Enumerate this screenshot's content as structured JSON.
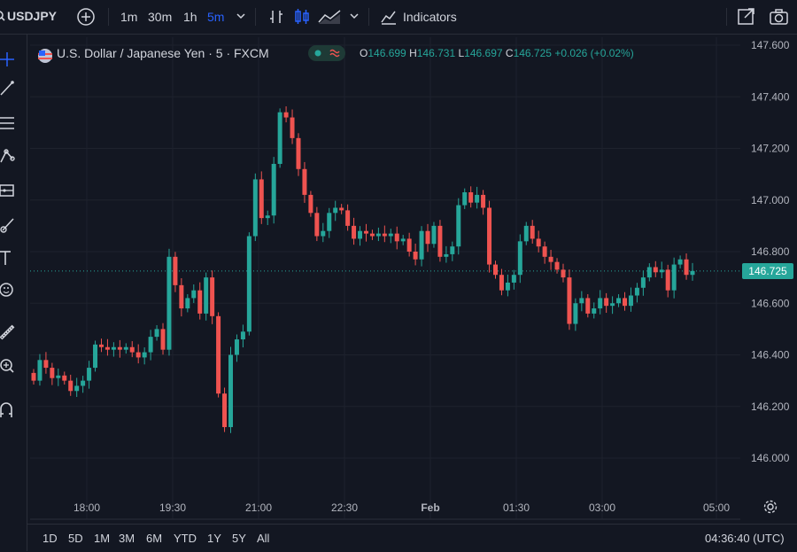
{
  "topbar": {
    "symbol": "USDJPY",
    "timeframes": [
      "1m",
      "30m",
      "1h",
      "5m"
    ],
    "active_timeframe": "5m",
    "indicators_label": "Indicators"
  },
  "legend": {
    "title": "U.S. Dollar / Japanese Yen · 5 · FXCM",
    "o_label": "O",
    "o_value": "146.699",
    "h_label": "H",
    "h_value": "146.731",
    "l_label": "L",
    "l_value": "146.697",
    "c_label": "C",
    "c_value": "146.725",
    "change": "+0.026 (+0.02%)"
  },
  "price_axis": {
    "ticks": [
      "147.600",
      "147.400",
      "147.200",
      "147.000",
      "146.800",
      "146.600",
      "146.400",
      "146.200",
      "146.000"
    ],
    "current_price": "146.725"
  },
  "time_axis": {
    "ticks": [
      "18:00",
      "19:30",
      "21:00",
      "22:30",
      "Feb",
      "01:30",
      "03:00",
      "05:00"
    ]
  },
  "bottombar": {
    "ranges": [
      "1D",
      "5D",
      "1M",
      "3M",
      "6M",
      "YTD",
      "1Y",
      "5Y",
      "All"
    ],
    "clock": "04:36:40 (UTC)"
  },
  "colors": {
    "up": "#26a69a",
    "down": "#ef5350",
    "background": "#131722",
    "accent": "#2962ff"
  },
  "chart_data": {
    "type": "candlestick",
    "xlabel": "",
    "ylabel": "",
    "ylim": [
      145.9,
      147.62
    ],
    "x_ticks": [
      "18:00",
      "19:30",
      "21:00",
      "22:30",
      "Feb",
      "01:30",
      "03:00",
      "05:00"
    ],
    "y_ticks": [
      147.6,
      147.4,
      147.2,
      147.0,
      146.8,
      146.6,
      146.4,
      146.2,
      146.0
    ],
    "last_price": 146.725,
    "closes": [
      146.3,
      146.38,
      146.35,
      146.31,
      146.32,
      146.3,
      146.26,
      146.28,
      146.3,
      146.35,
      146.44,
      146.43,
      146.42,
      146.43,
      146.42,
      146.43,
      146.41,
      146.39,
      146.41,
      146.47,
      146.5,
      146.42,
      146.78,
      146.67,
      146.58,
      146.62,
      146.65,
      146.56,
      146.7,
      146.55,
      146.25,
      146.12,
      146.4,
      146.46,
      146.49,
      146.86,
      147.08,
      146.93,
      146.94,
      147.14,
      147.34,
      147.32,
      147.24,
      147.12,
      147.02,
      146.95,
      146.86,
      146.88,
      146.95,
      146.97,
      146.96,
      146.9,
      146.85,
      146.88,
      146.87,
      146.86,
      146.87,
      146.86,
      146.87,
      146.84,
      146.85,
      146.8,
      146.77,
      146.88,
      146.83,
      146.9,
      146.78,
      146.79,
      146.82,
      146.98,
      147.03,
      146.99,
      147.02,
      146.97,
      146.75,
      146.71,
      146.65,
      146.68,
      146.71,
      146.84,
      146.9,
      146.85,
      146.82,
      146.78,
      146.76,
      146.73,
      146.7,
      146.52,
      146.6,
      146.62,
      146.56,
      146.58,
      146.62,
      146.59,
      146.6,
      146.62,
      146.59,
      146.63,
      146.66,
      146.7,
      146.74,
      146.72,
      146.73,
      146.65,
      146.75,
      146.77,
      146.71,
      146.725
    ],
    "highs_note": ""
  }
}
